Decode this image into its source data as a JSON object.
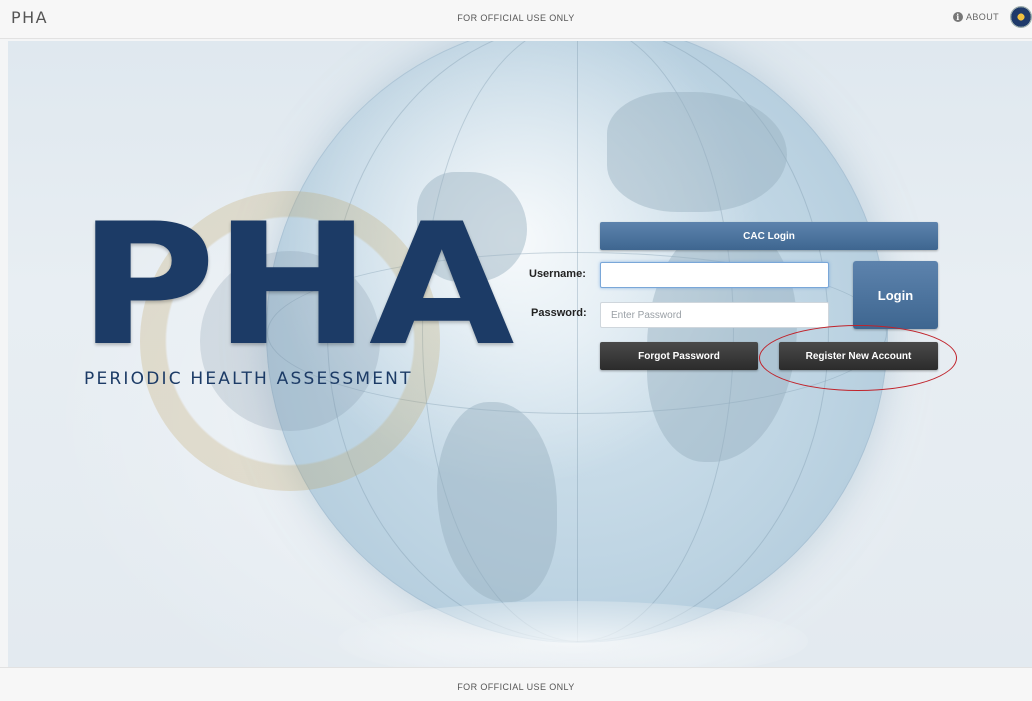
{
  "header": {
    "brand": "PHA",
    "banner": "FOR OFFICIAL USE ONLY",
    "about_label": "ABOUT",
    "about_icon": "info-circle-icon",
    "seal_icon": "navy-seal-icon"
  },
  "hero": {
    "title": "PHA",
    "subtitle": "PERIODIC HEALTH ASSESSMENT"
  },
  "login_form": {
    "cac_label": "CAC Login",
    "username_label": "Username:",
    "username_value": "",
    "password_label": "Password:",
    "password_placeholder": "Enter Password",
    "login_label": "Login",
    "forgot_label": "Forgot Password",
    "register_label": "Register New Account"
  },
  "footer": {
    "banner": "FOR OFFICIAL USE ONLY"
  },
  "colors": {
    "primary_blue": "#3e6690",
    "title_navy": "#1c3b66",
    "dark_button": "#2b2b2b",
    "annotation_red": "#c0232b"
  }
}
